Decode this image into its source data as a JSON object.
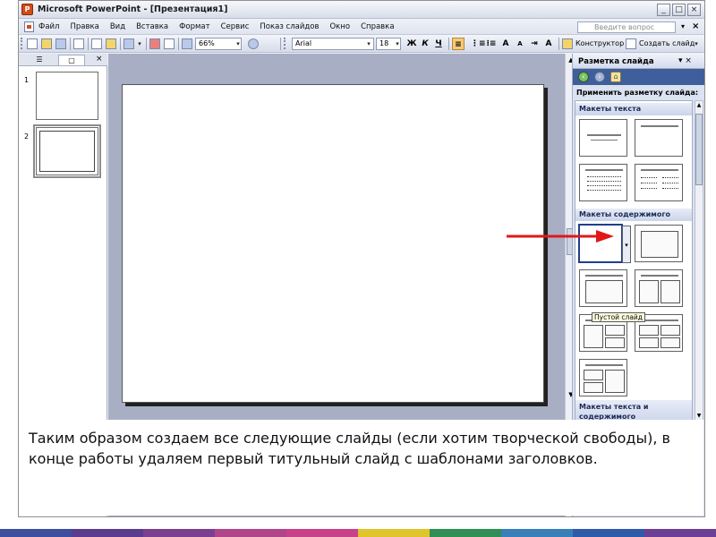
{
  "window": {
    "title": "Microsoft PowerPoint - [Презентация1]",
    "buttons": [
      "_",
      "□",
      "×"
    ]
  },
  "menu": {
    "items": [
      "Файл",
      "Правка",
      "Вид",
      "Вставка",
      "Формат",
      "Сервис",
      "Показ слайдов",
      "Окно",
      "Справка"
    ],
    "help_placeholder": "Введите вопрос",
    "close_symbol": "×"
  },
  "toolbar": {
    "zoom": "66%",
    "font": "Arial",
    "font_size": "18",
    "bold": "Ж",
    "italic": "К",
    "underline": "Ч",
    "designer_label": "Конструктор",
    "new_slide_label": "Создать слайд"
  },
  "outline": {
    "tabs": [
      "☰",
      "▢"
    ],
    "close_symbol": "×",
    "slides": [
      {
        "number": "1",
        "selected": false
      },
      {
        "number": "2",
        "selected": true
      }
    ]
  },
  "task_pane": {
    "title": "Разметка слайда",
    "header_buttons": "▾ ×",
    "apply_label": "Применить разметку слайда:",
    "sections": {
      "text_layouts": "Макеты текста",
      "content_layouts": "Макеты содержимого",
      "text_and_content_line1": "Макеты текста и",
      "text_and_content_line2": "содержимого"
    },
    "tooltip": "Пустой слайд"
  },
  "caption": {
    "text": "Таким образом создаем все следующие слайды (если хотим творческой свободы), в конце работы удаляем первый титульный слайд с шаблонами заголовков."
  },
  "colors": {
    "workspace": "#a8aec4",
    "accent_arrow": "#e01818",
    "nav_bar": "#3f5e9c",
    "stripe": [
      "#3d4f9e",
      "#5a3b8c",
      "#7b3f8f",
      "#b0458a",
      "#c8428a",
      "#e0c52a",
      "#2f8f54",
      "#3a7fb8",
      "#2e5aa8",
      "#6b3f94"
    ]
  }
}
